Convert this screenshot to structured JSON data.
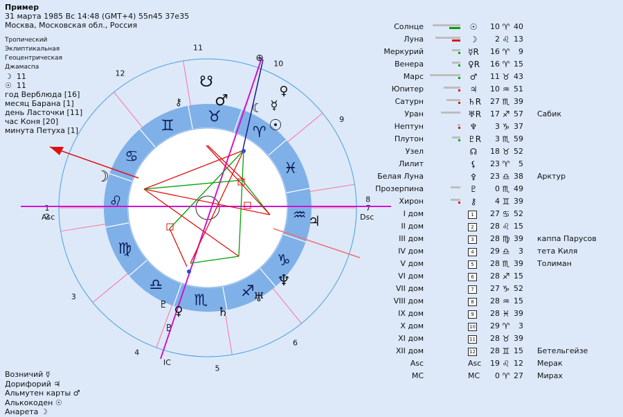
{
  "header": {
    "title": "Пример",
    "line1": "31 марта 1985  Вс  14:48 (GMT+4) 55n45  37e35",
    "line2": "Москва, Московская обл., Россия"
  },
  "system": {
    "zodiac": "Тропический",
    "coordinates": "Эклиптикальная",
    "center": "Геоцентрическая",
    "other": "Джамаспа",
    "moon_val": "11",
    "sun_val": "11",
    "year": "год Верблюда [16]",
    "month": "месяц Барана [1]",
    "day": "день Ласточки [11]",
    "hour": "час Коня [20]",
    "minute": "минута Петуха [1]"
  },
  "rulers": {
    "vozn": "Возничий",
    "vozn_glyph": "☿",
    "dorif": "Дорифорий",
    "dorif_glyph": "♃",
    "almuten": "Альмутен карты",
    "almuten_glyph": "♂",
    "alko": "Алькокоден",
    "alko_glyph": "☉",
    "anareta": "Анарета",
    "anareta_glyph": "☽"
  },
  "chart_labels": {
    "asc": "Asc",
    "dsc": "Dsc",
    "ic": "IC",
    "houses": [
      "1",
      "2",
      "3",
      "4",
      "5",
      "6",
      "7",
      "8",
      "9",
      "10",
      "11",
      "12"
    ]
  },
  "planets": [
    {
      "name": "Солнце",
      "glyph": "☉",
      "deg": "10",
      "sign": "♈",
      "min": "40",
      "star": "",
      "c1": "#00a000",
      "w1": 40,
      "w2": 16
    },
    {
      "name": "Луна",
      "glyph": "☽",
      "deg": "2",
      "sign": "♌",
      "min": "13",
      "star": "",
      "c1": "#e01010",
      "w1": 36,
      "w2": 12
    },
    {
      "name": "Меркурий",
      "glyph": "☿R",
      "deg": "16",
      "sign": "♈",
      "min": "9",
      "star": "",
      "c1": "#00a000",
      "w1": 12,
      "w2": 3
    },
    {
      "name": "Венера",
      "glyph": "♀R",
      "deg": "16",
      "sign": "♈",
      "min": "15",
      "star": "",
      "c1": "#00a000",
      "w1": 12,
      "w2": 3
    },
    {
      "name": "Марс",
      "glyph": "♂",
      "deg": "11",
      "sign": "♉",
      "min": "43",
      "star": "",
      "c1": "#00a000",
      "w1": 44,
      "w2": 3
    },
    {
      "name": "Юпитер",
      "glyph": "♃",
      "deg": "10",
      "sign": "♒",
      "min": "51",
      "star": "",
      "c1": "#e01010",
      "w1": 24,
      "w2": 3
    },
    {
      "name": "Сатурн",
      "glyph": "♄R",
      "deg": "27",
      "sign": "♏",
      "min": "39",
      "star": "",
      "c1": "#e01010",
      "w1": 20,
      "w2": 3
    },
    {
      "name": "Уран",
      "glyph": "♅R",
      "deg": "17",
      "sign": "♐",
      "min": "57",
      "star": "Сабик",
      "c1": "#bdbdbd",
      "w1": 28,
      "w2": 0
    },
    {
      "name": "Нептун",
      "glyph": "♆",
      "deg": "3",
      "sign": "♑",
      "min": "37",
      "star": "",
      "c1": "#e01010",
      "w1": 4,
      "w2": 3
    },
    {
      "name": "Плутон",
      "glyph": "♇R",
      "deg": "3",
      "sign": "♏",
      "min": "59",
      "star": "",
      "c1": "#00a000",
      "w1": 12,
      "w2": 3
    },
    {
      "name": "Узел",
      "glyph": "☊",
      "deg": "18",
      "sign": "♉",
      "min": "52",
      "star": "",
      "c1": "",
      "w1": 0,
      "w2": 0
    },
    {
      "name": "Лилит",
      "glyph": "⚸",
      "deg": "23",
      "sign": "♈",
      "min": "5",
      "star": "",
      "c1": "",
      "w1": 0,
      "w2": 0
    },
    {
      "name": "Белая Луна",
      "glyph": "⚴",
      "deg": "23",
      "sign": "♎",
      "min": "38",
      "star": "Арктур",
      "c1": "",
      "w1": 0,
      "w2": 0
    },
    {
      "name": "Прозерпина",
      "glyph": "♇",
      "deg": "0",
      "sign": "♏",
      "min": "49",
      "star": "",
      "c1": "",
      "w1": 14,
      "w2": 0
    },
    {
      "name": "Хирон",
      "glyph": "⚷",
      "deg": "4",
      "sign": "♊",
      "min": "39",
      "star": "",
      "c1": "#e01010",
      "w1": 14,
      "w2": 3
    }
  ],
  "houses_table": [
    {
      "name": "I дом",
      "num": "1",
      "deg": "27",
      "sign": "♋",
      "min": "52",
      "star": ""
    },
    {
      "name": "II дом",
      "num": "2",
      "deg": "28",
      "sign": "♌",
      "min": "15",
      "star": ""
    },
    {
      "name": "III дом",
      "num": "3",
      "deg": "28",
      "sign": "♍",
      "min": "39",
      "star": "каппа Парусов"
    },
    {
      "name": "IV дом",
      "num": "4",
      "deg": "29",
      "sign": "♎",
      "min": "3",
      "star": "тета Киля"
    },
    {
      "name": "V дом",
      "num": "5",
      "deg": "28",
      "sign": "♏",
      "min": "39",
      "star": "Толиман"
    },
    {
      "name": "VI дом",
      "num": "6",
      "deg": "28",
      "sign": "♐",
      "min": "15",
      "star": ""
    },
    {
      "name": "VII дом",
      "num": "7",
      "deg": "27",
      "sign": "♑",
      "min": "52",
      "star": ""
    },
    {
      "name": "VIII дом",
      "num": "8",
      "deg": "28",
      "sign": "♒",
      "min": "15",
      "star": ""
    },
    {
      "name": "IX дом",
      "num": "9",
      "deg": "28",
      "sign": "♓",
      "min": "39",
      "star": ""
    },
    {
      "name": "X дом",
      "num": "10",
      "deg": "29",
      "sign": "♈",
      "min": "3",
      "star": ""
    },
    {
      "name": "XI дом",
      "num": "11",
      "deg": "28",
      "sign": "♉",
      "min": "39",
      "star": ""
    },
    {
      "name": "XII дом",
      "num": "12",
      "deg": "28",
      "sign": "♊",
      "min": "15",
      "star": "Бетельгейзе"
    },
    {
      "name": "Asc",
      "num": "Asc",
      "deg": "19",
      "sign": "♌",
      "min": "12",
      "star": "Мерак"
    },
    {
      "name": "MC",
      "num": "MC",
      "deg": "0",
      "sign": "♈",
      "min": "27",
      "star": "Мирах"
    }
  ]
}
